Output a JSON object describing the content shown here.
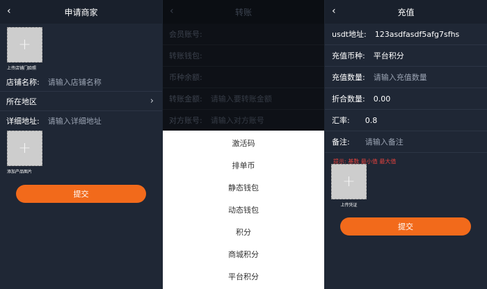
{
  "merchant": {
    "title": "申请商家",
    "upload_shop_caption": "上传店铺门脸照",
    "shop_name_label": "店铺名称:",
    "shop_name_placeholder": "请输入店铺名称",
    "region_label": "所在地区",
    "address_label": "详细地址:",
    "address_placeholder": "请输入详细地址",
    "upload_product_caption": "添加产品图片",
    "submit_label": "提交"
  },
  "transfer": {
    "title": "转账",
    "fields": [
      {
        "label": "会员账号:",
        "placeholder": ""
      },
      {
        "label": "转账钱包:",
        "placeholder": ""
      },
      {
        "label": "币种余额:",
        "placeholder": ""
      },
      {
        "label": "转账金额:",
        "placeholder": "请输入要转账金额"
      },
      {
        "label": "对方账号:",
        "placeholder": "请输入对方账号"
      }
    ],
    "options": [
      "激活码",
      "排单币",
      "静态钱包",
      "动态钱包",
      "积分",
      "商城积分",
      "平台积分"
    ]
  },
  "recharge": {
    "title": "充值",
    "usdt_label": "usdt地址:",
    "usdt_value": "123asdfasdf5afg7sfhs",
    "currency_label": "充值币种:",
    "currency_value": "平台积分",
    "amount_label": "充值数量:",
    "amount_placeholder": "请输入充值数量",
    "converted_label": "折合数量:",
    "converted_value": "0.00",
    "rate_label": "汇率:",
    "rate_value": "0.8",
    "remark_label": "备注:",
    "remark_placeholder": "请输入备注",
    "hint": "提示: 基数 最小值 最大值",
    "upload_caption": "上传凭证",
    "submit_label": "提交"
  },
  "icons": {
    "back": "back-arrow-icon",
    "plus": "plus-icon",
    "chevron": "chevron-right-icon"
  },
  "colors": {
    "accent": "#f26a1b",
    "hint": "#e2423d",
    "bg": "#1f2735"
  }
}
